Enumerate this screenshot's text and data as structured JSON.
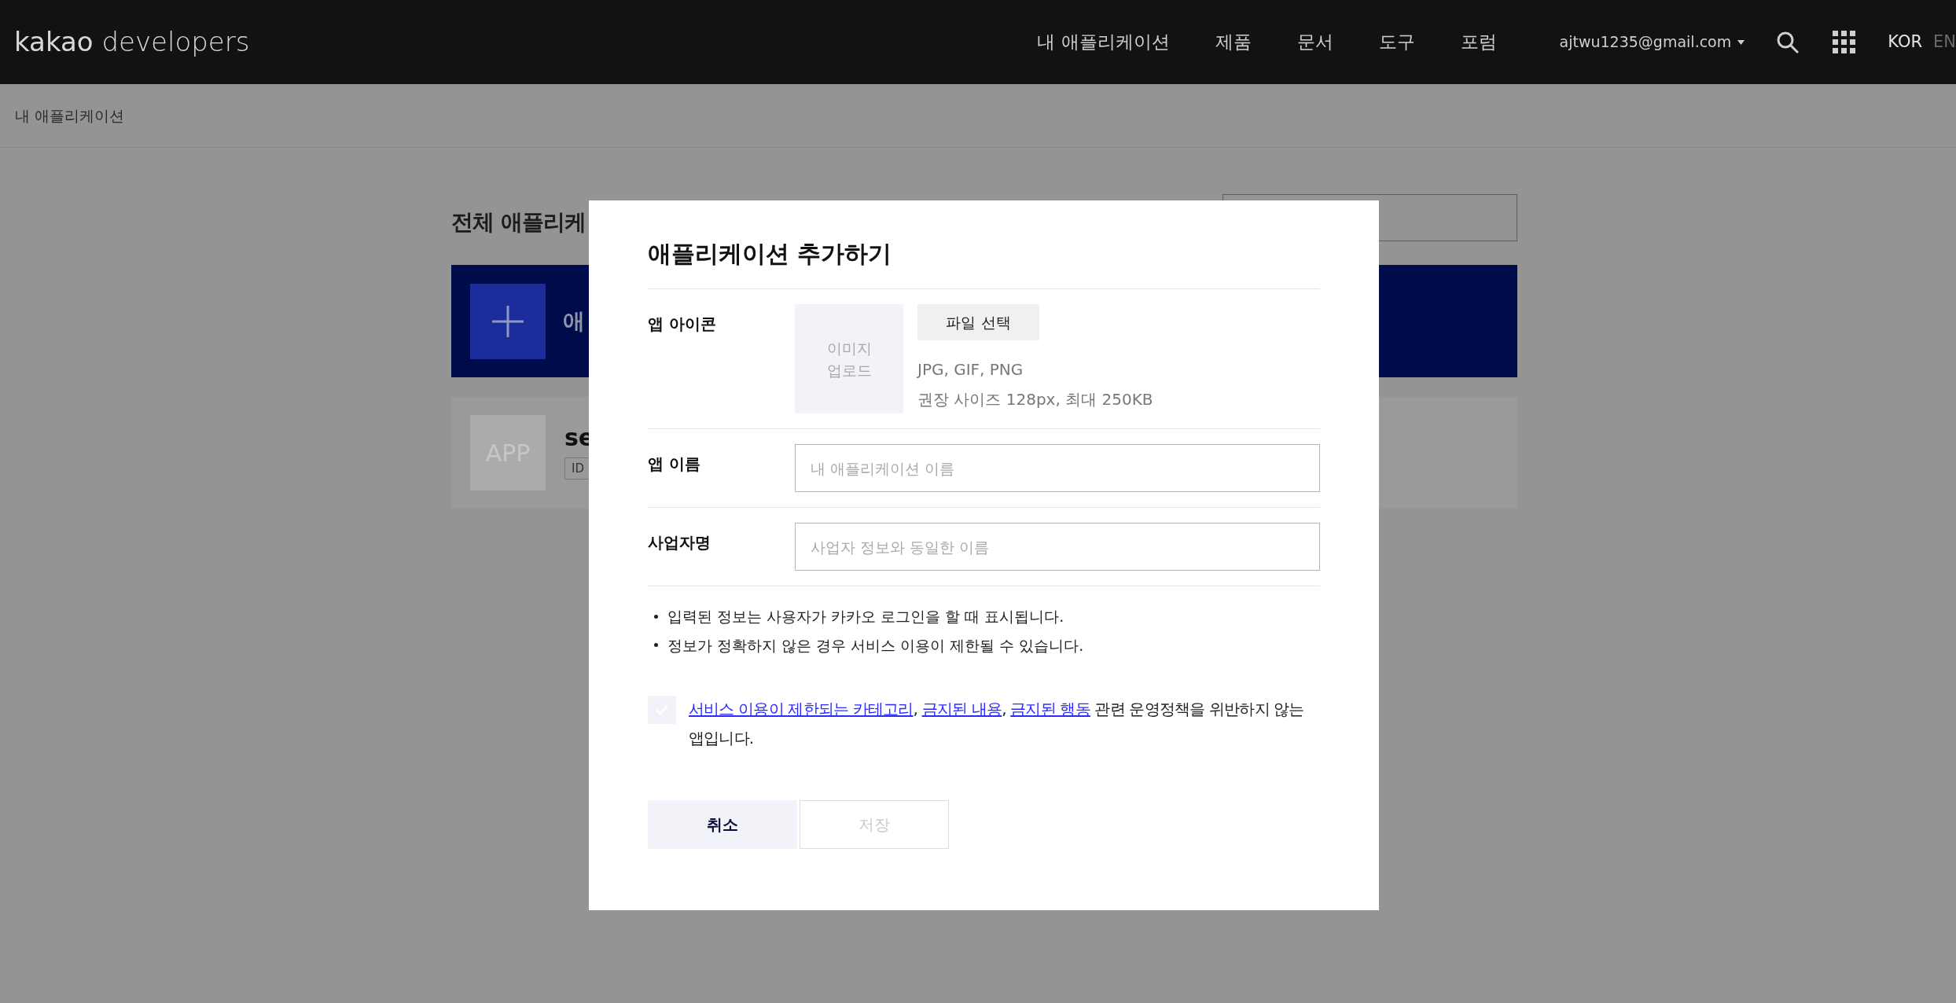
{
  "header": {
    "logo": {
      "brand": "kakao",
      "product": "developers"
    },
    "nav": [
      {
        "label": "내 애플리케이션"
      },
      {
        "label": "제품"
      },
      {
        "label": "문서"
      },
      {
        "label": "도구"
      },
      {
        "label": "포럼"
      }
    ],
    "account": "ajtwu1235@gmail.com",
    "languages": [
      {
        "label": "KOR",
        "selected": true
      },
      {
        "label": "EN",
        "selected": false
      }
    ]
  },
  "breadcrumb": "내 애플리케이션",
  "background": {
    "heading": "전체 애플리케",
    "add_card_label": "애",
    "app_card": {
      "icon_text": "APP",
      "name": "se",
      "id_badge": "ID"
    }
  },
  "modal": {
    "title": "애플리케이션 추가하기",
    "icon_row": {
      "label": "앱 아이콘",
      "upload_text": "이미지\n업로드",
      "file_button": "파일 선택",
      "formats": "JPG, GIF, PNG",
      "size_hint": "권장 사이즈 128px, 최대 250KB"
    },
    "fields": [
      {
        "label": "앱 이름",
        "placeholder": "내 애플리케이션 이름"
      },
      {
        "label": "사업자명",
        "placeholder": "사업자 정보와 동일한 이름"
      }
    ],
    "notes": [
      "입력된 정보는 사용자가 카카오 로그인을 할 때 표시됩니다.",
      "정보가 정확하지 않은 경우 서비스 이용이 제한될 수 있습니다."
    ],
    "agreement": {
      "checked": false,
      "parts": [
        {
          "kind": "link",
          "text": "서비스 이용이 제한되는 카테고리"
        },
        {
          "kind": "text",
          "text": ", "
        },
        {
          "kind": "link",
          "text": "금지된 내용"
        },
        {
          "kind": "text",
          "text": ", "
        },
        {
          "kind": "link",
          "text": "금지된 행동"
        },
        {
          "kind": "text",
          "text": " 관련 운영정책을 위반하지 않는 앱입니다."
        }
      ]
    },
    "buttons": [
      {
        "label": "취소",
        "disabled": false
      },
      {
        "label": "저장",
        "disabled": true
      }
    ]
  }
}
